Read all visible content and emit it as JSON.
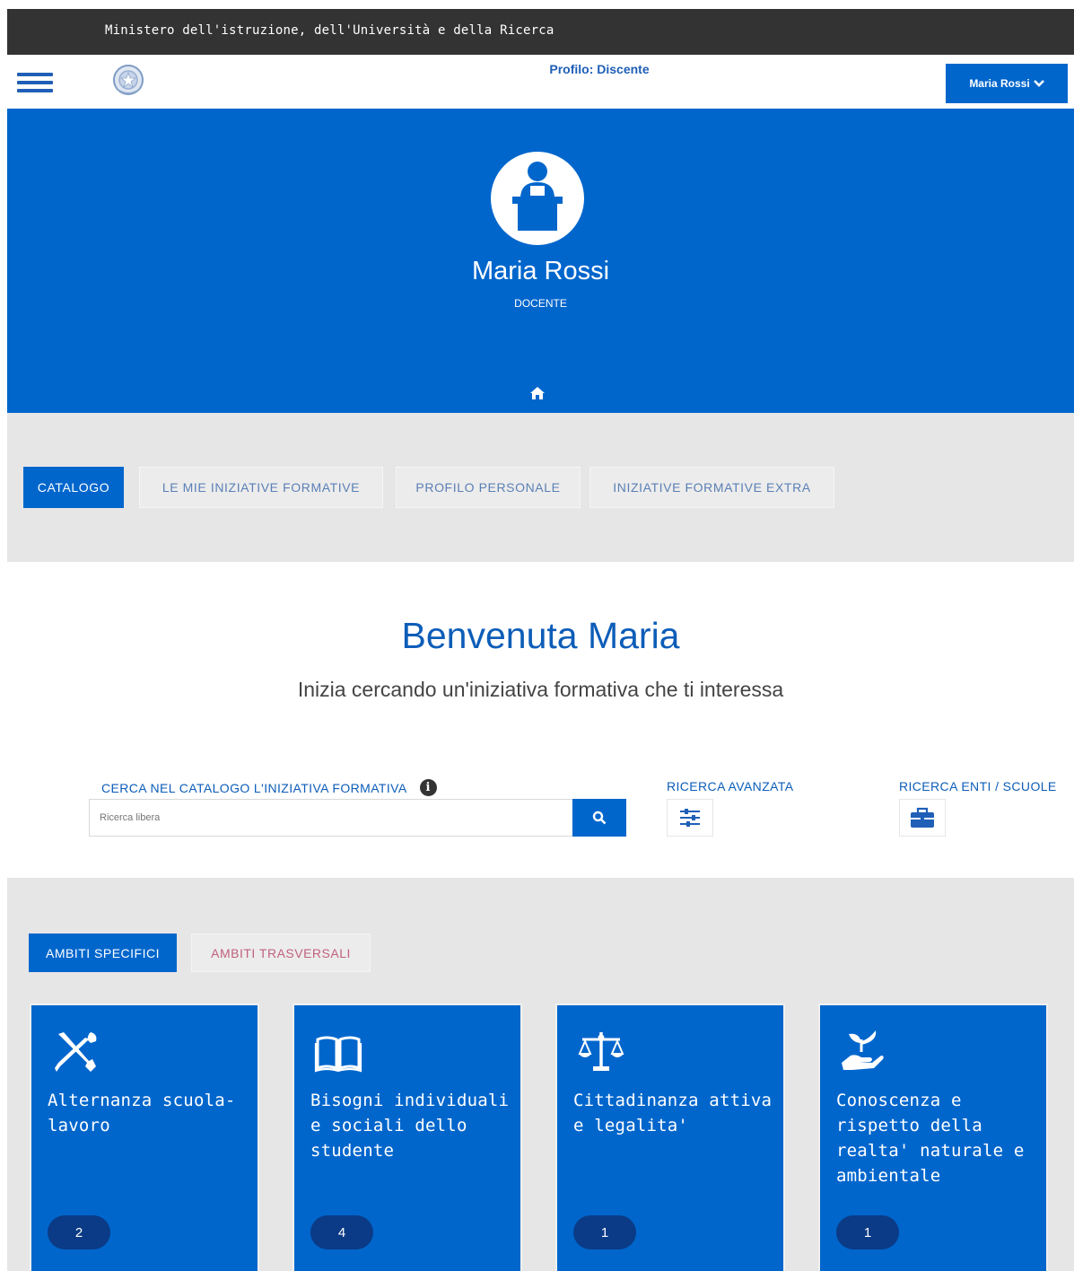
{
  "ministry_bar": {
    "text": "Ministero dell'istruzione, dell'Università e della Ricerca"
  },
  "header": {
    "profile_text": "Profilo: Discente",
    "user_button_label": "Maria Rossi"
  },
  "hero": {
    "name": "Maria Rossi",
    "role": "DOCENTE"
  },
  "main_tabs": [
    {
      "label": "CATALOGO",
      "active": true
    },
    {
      "label": "LE MIE INIZIATIVE FORMATIVE",
      "active": false
    },
    {
      "label": "PROFILO PERSONALE",
      "active": false
    },
    {
      "label": "INIZIATIVE FORMATIVE EXTRA",
      "active": false
    }
  ],
  "welcome": {
    "title": "Benvenuta Maria",
    "subtitle": "Inizia cercando un'iniziativa formativa che ti interessa"
  },
  "search": {
    "label": "CERCA NEL CATALOGO L'INIZIATIVA FORMATIVA",
    "info_glyph": "i",
    "placeholder": "Ricerca libera",
    "advanced_label": "RICERCA AVANZATA",
    "enti_label": "RICERCA ENTI / SCUOLE"
  },
  "ambiti_tabs": [
    {
      "label": "AMBITI SPECIFICI",
      "active": true
    },
    {
      "label": "AMBITI TRASVERSALI",
      "active": false
    }
  ],
  "cards": [
    {
      "title": "Alternanza scuola-lavoro",
      "count": "2",
      "icon": "tools-icon"
    },
    {
      "title": "Bisogni individuali e sociali dello studente",
      "count": "4",
      "icon": "book-icon"
    },
    {
      "title": "Cittadinanza attiva e legalita'",
      "count": "1",
      "icon": "balance-icon"
    },
    {
      "title": "Conoscenza e rispetto della realta' naturale e ambientale",
      "count": "1",
      "icon": "plant-hand-icon"
    }
  ],
  "colors": {
    "primary": "#0066cc",
    "dark_bar": "#333333",
    "panel_gray": "#e6e6e6",
    "badge": "#0b3b86",
    "trasversali_text": "#c0627d"
  }
}
